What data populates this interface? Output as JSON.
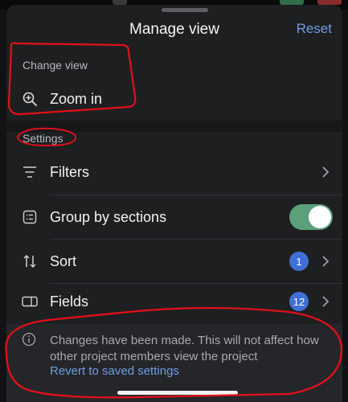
{
  "sheet": {
    "title": "Manage view",
    "reset_label": "Reset"
  },
  "change_view": {
    "heading": "Change view",
    "zoom_label": "Zoom in"
  },
  "settings": {
    "heading": "Settings",
    "rows": [
      {
        "label": "Filters"
      },
      {
        "label": "Group by sections",
        "toggle_on": true
      },
      {
        "label": "Sort",
        "badge": "1"
      },
      {
        "label": "Fields",
        "badge": "12"
      }
    ]
  },
  "notice": {
    "message": "Changes have been made. This will not affect how other project members view the project",
    "link": "Revert to saved settings"
  },
  "colors": {
    "accent": "#6d9de6",
    "toggle_on": "#5ba07a",
    "badge": "#3f6fd3",
    "annotation": "#e0101a"
  }
}
